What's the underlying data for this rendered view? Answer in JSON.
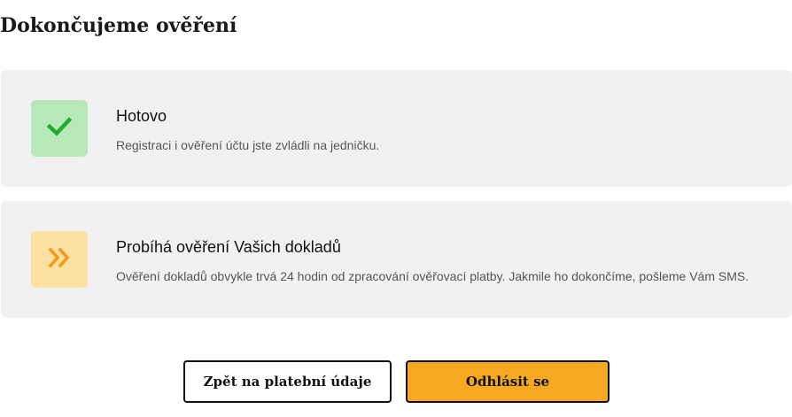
{
  "page": {
    "title": "Dokončujeme ověření"
  },
  "steps": [
    {
      "status": "done",
      "icon": "checkmark-icon",
      "color": "#22aa2a",
      "background": "#b7e8b9",
      "title": "Hotovo",
      "description": "Registraci i ověření účtu jste zvládli na jedničku."
    },
    {
      "status": "in-progress",
      "icon": "double-chevron-right-icon",
      "color": "#f29a11",
      "background": "#fde0a4",
      "title": "Probíhá ověření Vašich dokladů",
      "description": "Ověření dokladů obvykle trvá 24 hodin od zpracování ověřovací platby. Jakmile ho dokončíme, pošleme Vám SMS."
    }
  ],
  "actions": {
    "back_label": "Zpět na platební údaje",
    "logout_label": "Odhlásit se",
    "accent_color": "#f7a823"
  }
}
